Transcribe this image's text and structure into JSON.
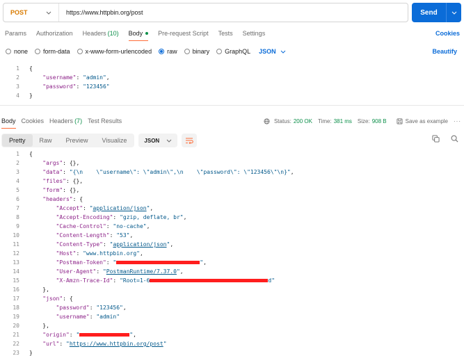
{
  "request": {
    "method": "POST",
    "url": "https://www.httpbin.org/post",
    "send_label": "Send"
  },
  "request_tabs": [
    {
      "label": "Params"
    },
    {
      "label": "Authorization"
    },
    {
      "label": "Headers",
      "count": "(10)"
    },
    {
      "label": "Body",
      "active": true
    },
    {
      "label": "Pre-request Script"
    },
    {
      "label": "Tests"
    },
    {
      "label": "Settings"
    }
  ],
  "cookies_label": "Cookies",
  "body_types": [
    "none",
    "form-data",
    "x-www-form-urlencoded",
    "raw",
    "binary",
    "GraphQL"
  ],
  "body_type_selected": "raw",
  "body_format": "JSON",
  "beautify_label": "Beautify",
  "request_body_lines": [
    {
      "n": "1",
      "text": "{"
    },
    {
      "n": "2",
      "text": "    \"username\": \"admin\","
    },
    {
      "n": "3",
      "text": "    \"password\": \"123456\""
    },
    {
      "n": "4",
      "text": "}"
    }
  ],
  "response_tabs": [
    {
      "label": "Body",
      "active": true
    },
    {
      "label": "Cookies"
    },
    {
      "label": "Headers",
      "count": "(7)"
    },
    {
      "label": "Test Results"
    }
  ],
  "response_status": {
    "status_label": "Status:",
    "status_value": "200 OK",
    "time_label": "Time:",
    "time_value": "381 ms",
    "size_label": "Size:",
    "size_value": "908 B",
    "save_label": "Save as example",
    "more": "···"
  },
  "view_modes": [
    "Pretty",
    "Raw",
    "Preview",
    "Visualize"
  ],
  "view_mode_selected": "Pretty",
  "response_format": "JSON",
  "response_body_lines": [
    {
      "n": "1",
      "text": "{"
    },
    {
      "n": "2",
      "text": "    \"args\": {},"
    },
    {
      "n": "3",
      "text": "    \"data\": \"{\\n    \\\"username\\\": \\\"admin\\\",\\n    \\\"password\\\": \\\"123456\\\"\\n}\","
    },
    {
      "n": "4",
      "text": "    \"files\": {},"
    },
    {
      "n": "5",
      "text": "    \"form\": {},"
    },
    {
      "n": "6",
      "text": "    \"headers\": {"
    },
    {
      "n": "7",
      "text": "        \"Accept\": \"application/json\","
    },
    {
      "n": "8",
      "text": "        \"Accept-Encoding\": \"gzip, deflate, br\","
    },
    {
      "n": "9",
      "text": "        \"Cache-Control\": \"no-cache\","
    },
    {
      "n": "10",
      "text": "        \"Content-Length\": \"53\","
    },
    {
      "n": "11",
      "text": "        \"Content-Type\": \"application/json\","
    },
    {
      "n": "12",
      "text": "        \"Host\": \"www.httpbin.org\","
    },
    {
      "n": "13",
      "text": "        \"Postman-Token\": \"█\","
    },
    {
      "n": "14",
      "text": "        \"User-Agent\": \"PostmanRuntime/7.37.0\","
    },
    {
      "n": "15",
      "text": "        \"X-Amzn-Trace-Id\": \"Root=1-6█d\""
    },
    {
      "n": "16",
      "text": "    },"
    },
    {
      "n": "17",
      "text": "    \"json\": {"
    },
    {
      "n": "18",
      "text": "        \"password\": \"123456\","
    },
    {
      "n": "19",
      "text": "        \"username\": \"admin\""
    },
    {
      "n": "20",
      "text": "    },"
    },
    {
      "n": "21",
      "text": "    \"origin\": \"█\","
    },
    {
      "n": "22",
      "text": "    \"url\": \"https://www.httpbin.org/post\""
    },
    {
      "n": "23",
      "text": "}"
    }
  ],
  "colors": {
    "accent_blue": "#0b6cd8",
    "method_orange": "#d97b00",
    "active_tab_underline": "#ff6c37",
    "status_green": "#0c8f4a",
    "json_key": "#8b1f87",
    "json_string": "#00578a",
    "redaction": "#ff1e1e"
  },
  "icons": [
    "chevron-down-icon",
    "globe-icon",
    "save-icon",
    "copy-icon",
    "search-icon",
    "wrap-lines-icon",
    "more-icon"
  ]
}
